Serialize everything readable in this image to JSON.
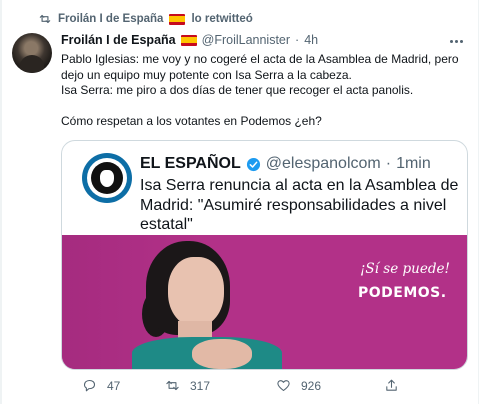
{
  "retweet_bar": {
    "label": "Froilán I de España",
    "suffix": "lo retwitteó",
    "icon": "retweet-icon"
  },
  "tweet": {
    "author_name": "Froilán I de España",
    "author_handle": "@FroilLannister",
    "separator": "·",
    "time": "4h",
    "lines": [
      "Pablo Iglesias: me voy y no cogeré el acta de la Asamblea de Madrid, pero",
      "dejo un equipo muy potente con Isa Serra a la cabeza.",
      "Isa Serra: me piro a dos días de tener que recoger el acta panolis.",
      "Cómo respetan a los votantes en Podemos ¿eh?"
    ]
  },
  "quoted": {
    "author_name": "EL ESPAÑOL",
    "author_handle": "@elespanolcom",
    "separator": "·",
    "time": "1min",
    "text": "Isa Serra renuncia al acta en la Asamblea de Madrid: \"Asumiré responsabilidades a nivel estatal\"",
    "image": {
      "slogan": "¡Sí se puede!",
      "brand": "PODEMOS."
    }
  },
  "actions": {
    "replies": "47",
    "retweets": "317",
    "likes": "926"
  },
  "colors": {
    "text": "#0f1419",
    "secondary": "#536471",
    "border": "#cfd9de",
    "verified": "#1d9bf0",
    "podemos": "#b23188",
    "flag_red": "#c60b1e",
    "flag_yellow": "#ffc400"
  }
}
